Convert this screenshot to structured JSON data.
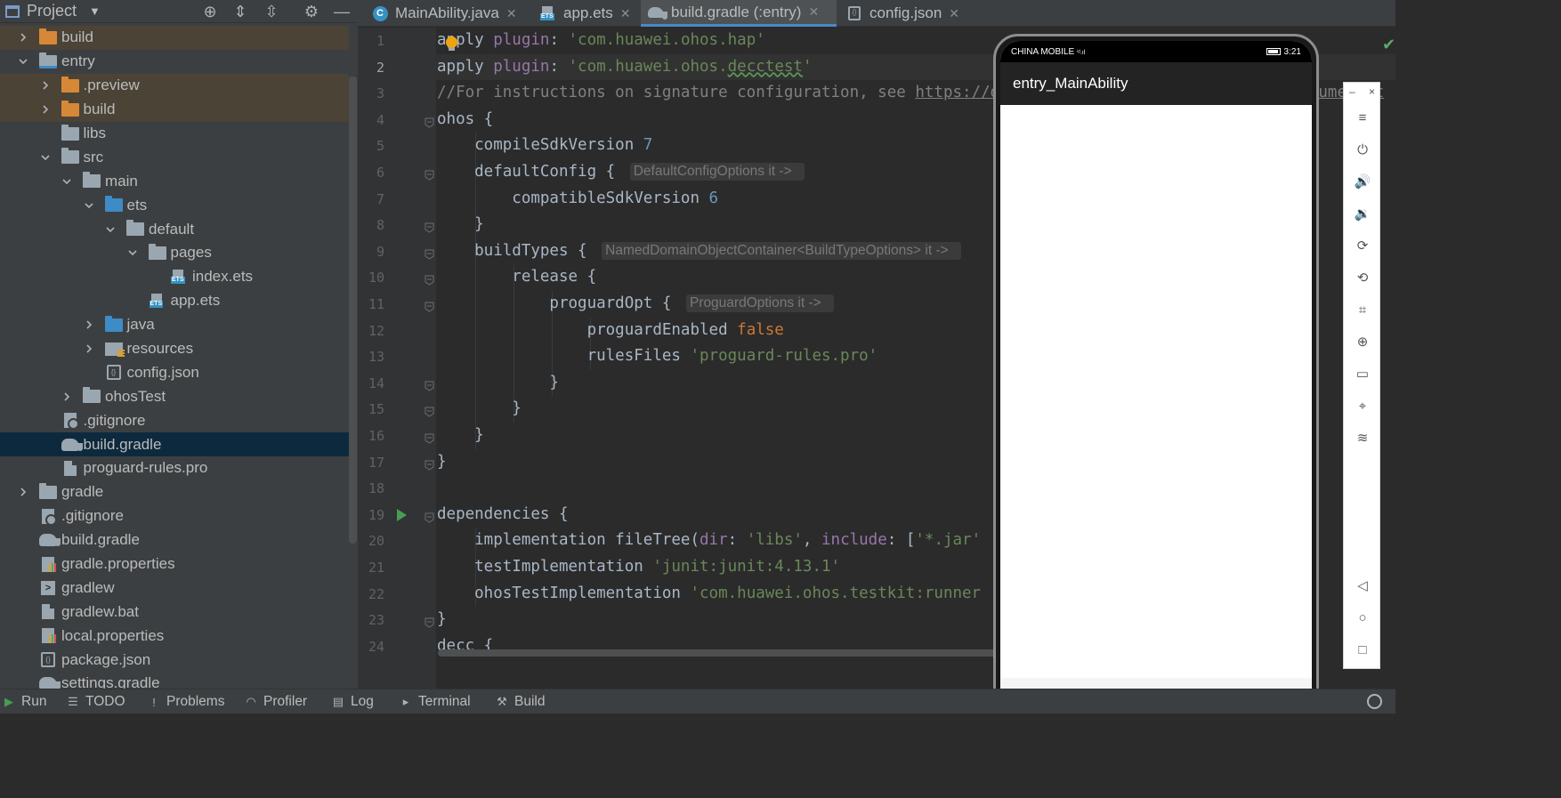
{
  "project_panel": {
    "title": "Project",
    "tree": [
      {
        "label": "build",
        "icon": "folder-orange-icon",
        "arrow": "right",
        "hl": true
      },
      {
        "label": "entry",
        "icon": "module-folder-icon",
        "arrow": "down",
        "bold": true
      },
      {
        "label": ".preview",
        "icon": "folder-orange-icon",
        "arrow": "right",
        "hl": true
      },
      {
        "label": "build",
        "icon": "folder-orange-icon",
        "arrow": "right",
        "hl": true
      },
      {
        "label": "libs",
        "icon": "folder-icon",
        "arrow": "none"
      },
      {
        "label": "src",
        "icon": "folder-icon",
        "arrow": "down"
      },
      {
        "label": "main",
        "icon": "folder-icon",
        "arrow": "down"
      },
      {
        "label": "ets",
        "icon": "folder-blue-icon",
        "arrow": "down"
      },
      {
        "label": "default",
        "icon": "folder-icon",
        "arrow": "down"
      },
      {
        "label": "pages",
        "icon": "folder-icon",
        "arrow": "down"
      },
      {
        "label": "index.ets",
        "icon": "ets-file-icon",
        "arrow": "none"
      },
      {
        "label": "app.ets",
        "icon": "ets-file-icon",
        "arrow": "none"
      },
      {
        "label": "java",
        "icon": "folder-blue-icon",
        "arrow": "right"
      },
      {
        "label": "resources",
        "icon": "resources-folder-icon",
        "arrow": "right"
      },
      {
        "label": "config.json",
        "icon": "json-file-icon",
        "arrow": "none"
      },
      {
        "label": "ohosTest",
        "icon": "folder-icon",
        "arrow": "right"
      },
      {
        "label": ".gitignore",
        "icon": "gitignore-file-icon",
        "arrow": "none"
      },
      {
        "label": "build.gradle",
        "icon": "gradle-elephant-icon",
        "arrow": "none",
        "selected": true
      },
      {
        "label": "proguard-rules.pro",
        "icon": "text-file-icon",
        "arrow": "none"
      },
      {
        "label": "gradle",
        "icon": "folder-icon",
        "arrow": "right"
      },
      {
        "label": ".gitignore",
        "icon": "gitignore-file-icon",
        "arrow": "none"
      },
      {
        "label": "build.gradle",
        "icon": "gradle-elephant-icon",
        "arrow": "none"
      },
      {
        "label": "gradle.properties",
        "icon": "properties-file-icon",
        "arrow": "none"
      },
      {
        "label": "gradlew",
        "icon": "shell-file-icon",
        "arrow": "none"
      },
      {
        "label": "gradlew.bat",
        "icon": "text-file-icon",
        "arrow": "none"
      },
      {
        "label": "local.properties",
        "icon": "properties-file-icon",
        "arrow": "none"
      },
      {
        "label": "package.json",
        "icon": "json-file-icon",
        "arrow": "none"
      },
      {
        "label": "settings.gradle",
        "icon": "gradle-elephant-icon",
        "arrow": "none"
      }
    ]
  },
  "tabs": [
    {
      "label": "MainAbility.java",
      "icon": "java-class-icon",
      "active": false
    },
    {
      "label": "app.ets",
      "icon": "ets-file-icon",
      "active": false
    },
    {
      "label": "build.gradle (:entry)",
      "icon": "gradle-elephant-icon",
      "active": true
    },
    {
      "label": "config.json",
      "icon": "json-file-icon",
      "active": false
    }
  ],
  "editor": {
    "line_numbers": [
      "1",
      "2",
      "3",
      "4",
      "5",
      "6",
      "7",
      "8",
      "9",
      "10",
      "11",
      "12",
      "13",
      "14",
      "15",
      "16",
      "17",
      "18",
      "19",
      "20",
      "21",
      "22",
      "23",
      "24"
    ],
    "current_line": 2,
    "lines": [
      [
        {
          "t": "apply "
        },
        {
          "t": "plugin",
          "c": "kw-plugin"
        },
        {
          "t": ": "
        },
        {
          "t": "'com.huawei.ohos.hap'",
          "c": "str"
        }
      ],
      [
        {
          "t": "apply "
        },
        {
          "t": "plugin",
          "c": "kw-plugin"
        },
        {
          "t": ": "
        },
        {
          "t": "'com.huawei.ohos.",
          "c": "str"
        },
        {
          "t": "decctest",
          "c": "str typo"
        },
        {
          "t": "'",
          "c": "str"
        }
      ],
      [
        {
          "t": "//For instructions on signature configuration, see ",
          "c": "cmt"
        },
        {
          "t": "https://developer.harmonyos.com/cn/docs/documentat",
          "c": "link"
        }
      ],
      [
        {
          "t": "ohos {"
        }
      ],
      [
        {
          "t": "    compileSdkVersion "
        },
        {
          "t": "7",
          "c": "num"
        }
      ],
      [
        {
          "t": "    defaultConfig { "
        },
        {
          "t": "DefaultConfigOptions it ->",
          "c": "hint"
        }
      ],
      [
        {
          "t": "        compatibleSdkVersion "
        },
        {
          "t": "6",
          "c": "num"
        }
      ],
      [
        {
          "t": "    }"
        }
      ],
      [
        {
          "t": "    buildTypes { "
        },
        {
          "t": "NamedDomainObjectContainer<BuildTypeOptions> it ->",
          "c": "hint"
        }
      ],
      [
        {
          "t": "        release {"
        }
      ],
      [
        {
          "t": "            proguardOpt { "
        },
        {
          "t": "ProguardOptions it ->",
          "c": "hint"
        }
      ],
      [
        {
          "t": "                proguardEnabled "
        },
        {
          "t": "false",
          "c": "kw"
        }
      ],
      [
        {
          "t": "                rulesFiles "
        },
        {
          "t": "'proguard-rules.pro'",
          "c": "str"
        }
      ],
      [
        {
          "t": "            }"
        }
      ],
      [
        {
          "t": "        }"
        }
      ],
      [
        {
          "t": "    }"
        }
      ],
      [
        {
          "t": "}"
        }
      ],
      [
        {
          "t": ""
        }
      ],
      [
        {
          "t": "dependencies {"
        }
      ],
      [
        {
          "t": "    implementation fileTree("
        },
        {
          "t": "dir",
          "c": "param"
        },
        {
          "t": ": "
        },
        {
          "t": "'libs'",
          "c": "str"
        },
        {
          "t": ", "
        },
        {
          "t": "include",
          "c": "param"
        },
        {
          "t": ": ["
        },
        {
          "t": "'*.jar'",
          "c": "str"
        }
      ],
      [
        {
          "t": "    testImplementation "
        },
        {
          "t": "'junit:junit:4.13.1'",
          "c": "str"
        }
      ],
      [
        {
          "t": "    ohosTestImplementation "
        },
        {
          "t": "'com.huawei.ohos.testkit:runner",
          "c": "str"
        }
      ],
      [
        {
          "t": "}"
        }
      ],
      [
        {
          "t": "decc {"
        }
      ]
    ]
  },
  "emulator": {
    "carrier": "CHINA MOBILE",
    "signal": "ⁱᵈ.ıl",
    "time": "3:21",
    "app_title": "entry_MainAbility",
    "toolbar": [
      {
        "name": "minimize-icon",
        "glyph": "–"
      },
      {
        "name": "close-icon",
        "glyph": "×"
      },
      {
        "name": "menu-icon",
        "glyph": "≡"
      },
      {
        "name": "power-icon",
        "glyph": "⏻"
      },
      {
        "name": "volume-up-icon",
        "glyph": "🔊"
      },
      {
        "name": "volume-down-icon",
        "glyph": "🔉"
      },
      {
        "name": "rotate-icon",
        "glyph": "⟳"
      },
      {
        "name": "rotate-reverse-icon",
        "glyph": "⟲"
      },
      {
        "name": "screenshot-crop-icon",
        "glyph": "⌗"
      },
      {
        "name": "zoom-icon",
        "glyph": "⊕"
      },
      {
        "name": "battery-icon",
        "glyph": "▭"
      },
      {
        "name": "location-icon",
        "glyph": "⌖"
      },
      {
        "name": "wifi-icon",
        "glyph": "≋"
      },
      {
        "name": "back-icon",
        "glyph": "◁"
      },
      {
        "name": "home-icon",
        "glyph": "○"
      },
      {
        "name": "recents-icon",
        "glyph": "□"
      }
    ]
  },
  "bottom_bar": [
    {
      "label": "Run",
      "icon": "run-icon",
      "glyph": "▶"
    },
    {
      "label": "TODO",
      "icon": "todo-icon",
      "glyph": "☰"
    },
    {
      "label": "Problems",
      "icon": "problems-icon",
      "glyph": "!"
    },
    {
      "label": "Profiler",
      "icon": "profiler-icon",
      "glyph": "◠"
    },
    {
      "label": "Log",
      "icon": "log-icon",
      "glyph": "▤"
    },
    {
      "label": "Terminal",
      "icon": "terminal-icon",
      "glyph": "▸"
    },
    {
      "label": "Build",
      "icon": "build-hammer-icon",
      "glyph": "⚒"
    }
  ],
  "colors": {
    "accent": "#4a88c7",
    "selection": "#0d293e",
    "panel": "#3c3f41",
    "editor_bg": "#2b2b2b"
  }
}
